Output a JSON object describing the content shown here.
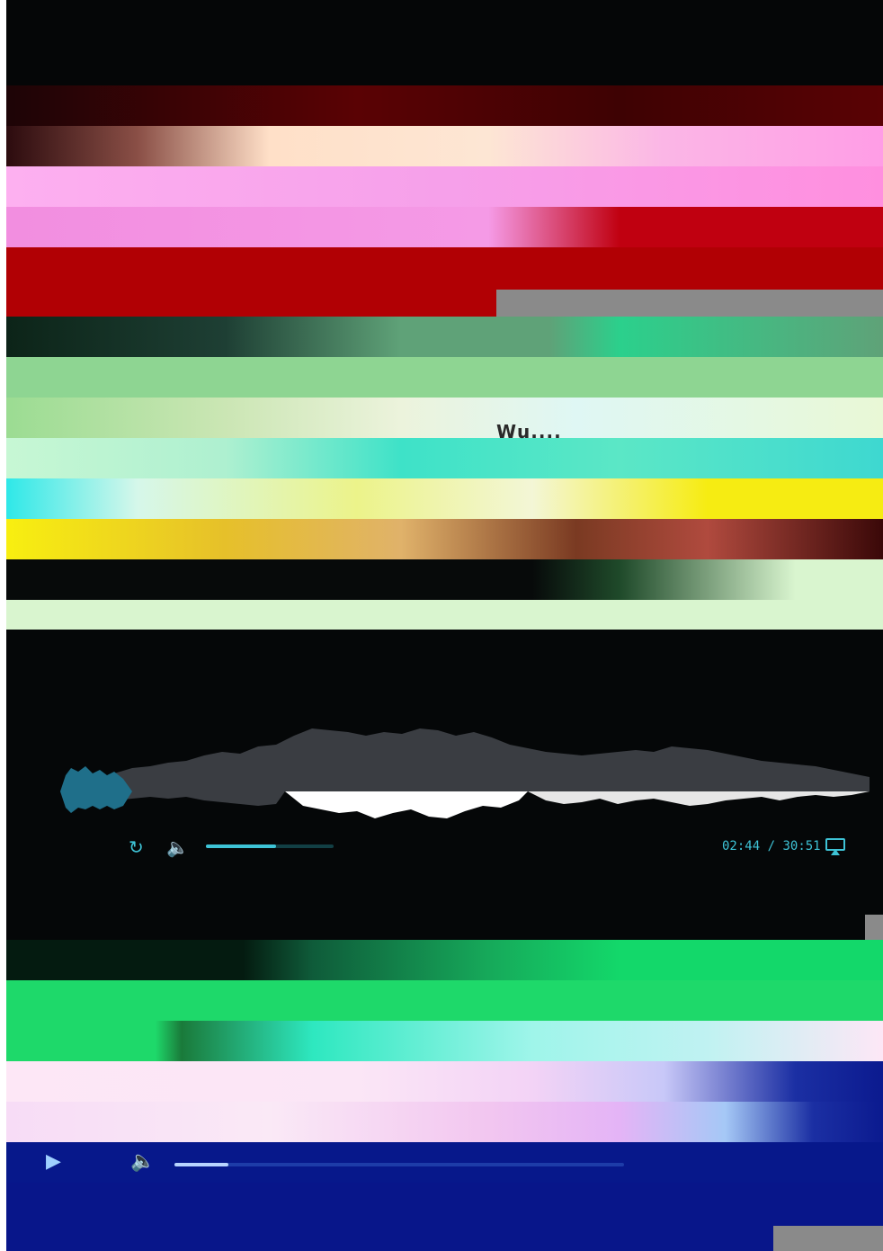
{
  "colors": {
    "player1": [
      "#050607",
      "#5a0204",
      "#c46a54",
      "#fdb0f0",
      "#f28ee0",
      "#c00010",
      "#b10004"
    ],
    "player2": [
      "#0c2418",
      "#5fa278",
      "#8ed592",
      "#9bdc92",
      "#dff7d7",
      "#3ee2c8",
      "#ecf38a",
      "#f6ec12",
      "#7a3a22",
      "#070a0a",
      "#d9f5cf"
    ],
    "player3": {
      "background": "#050708",
      "accent": "#3ec3d6",
      "waveform_played": "#ffffff",
      "waveform_unplayed": "#3a3d42"
    },
    "player4": [
      "#041b10",
      "#13d86a",
      "#1ed96a",
      "#b7f6ec",
      "#fde7f6",
      "#f7dcf6",
      "#1b2fa3",
      "#07188b",
      "#08168a"
    ]
  },
  "player2": {
    "caption": "Wu...."
  },
  "player3": {
    "icons": {
      "loop": "loop-icon",
      "volume": "volume-icon",
      "airplay": "airplay-icon"
    },
    "volume_level": 0.55,
    "time_current": "02:44",
    "time_separator": "/",
    "time_total": "30:51"
  },
  "player4": {
    "icons": {
      "play": "play-icon",
      "volume": "volume-icon"
    },
    "progress": 0.12
  }
}
